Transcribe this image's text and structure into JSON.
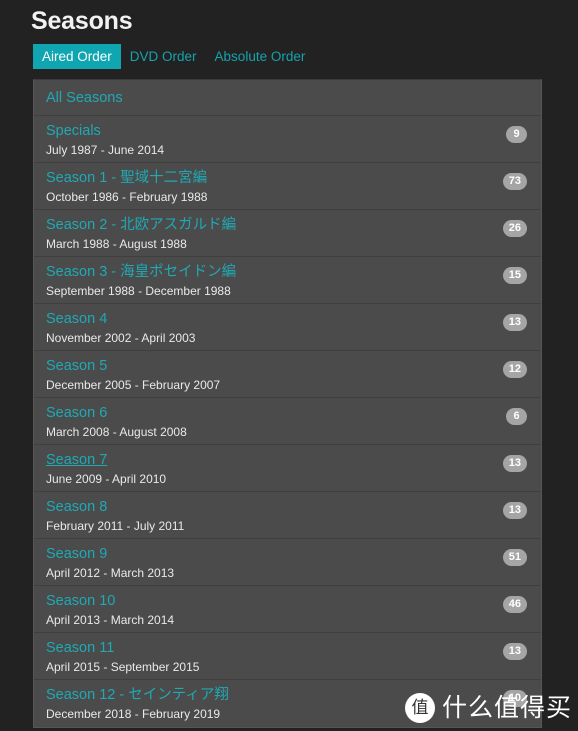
{
  "header": {
    "title": "Seasons"
  },
  "tabs": [
    {
      "label": "Aired Order",
      "active": true
    },
    {
      "label": "DVD Order",
      "active": false
    },
    {
      "label": "Absolute Order",
      "active": false
    }
  ],
  "list": {
    "all_seasons_label": "All Seasons",
    "rows": [
      {
        "name": "Specials",
        "dates": "July 1987 - June 2014",
        "count": "9",
        "hovered": false
      },
      {
        "name": "Season 1 - 聖域十二宮編",
        "dates": "October 1986 - February 1988",
        "count": "73",
        "hovered": false
      },
      {
        "name": "Season 2 - 北欧アスガルド編",
        "dates": "March 1988 - August 1988",
        "count": "26",
        "hovered": false
      },
      {
        "name": "Season 3 - 海皇ポセイドン編",
        "dates": "September 1988 - December 1988",
        "count": "15",
        "hovered": false
      },
      {
        "name": "Season 4",
        "dates": "November 2002 - April 2003",
        "count": "13",
        "hovered": false
      },
      {
        "name": "Season 5",
        "dates": "December 2005 - February 2007",
        "count": "12",
        "hovered": false
      },
      {
        "name": "Season 6",
        "dates": "March 2008 - August 2008",
        "count": "6",
        "hovered": false
      },
      {
        "name": "Season 7",
        "dates": "June 2009 - April 2010",
        "count": "13",
        "hovered": true
      },
      {
        "name": "Season 8",
        "dates": "February 2011 - July 2011",
        "count": "13",
        "hovered": false
      },
      {
        "name": "Season 9",
        "dates": "April 2012 - March 2013",
        "count": "51",
        "hovered": false
      },
      {
        "name": "Season 10",
        "dates": "April 2013 - March 2014",
        "count": "46",
        "hovered": false
      },
      {
        "name": "Season 11",
        "dates": "April 2015 - September 2015",
        "count": "13",
        "hovered": false
      },
      {
        "name": "Season 12 - セインティア翔",
        "dates": "December 2018 - February 2019",
        "count": "10",
        "hovered": false
      }
    ]
  },
  "watermark": {
    "logo_glyph": "值",
    "text": "什么值得买"
  },
  "colors": {
    "page_background": "#222222",
    "panel_background": "#4b4b4b",
    "accent_teal": "#0fa6b1",
    "link_teal": "#1fa9b4",
    "badge_background": "#a5a5a5",
    "row_separator": "#3f3f3f",
    "title_text": "#f2f2f2",
    "date_text": "#e9e9e9"
  }
}
